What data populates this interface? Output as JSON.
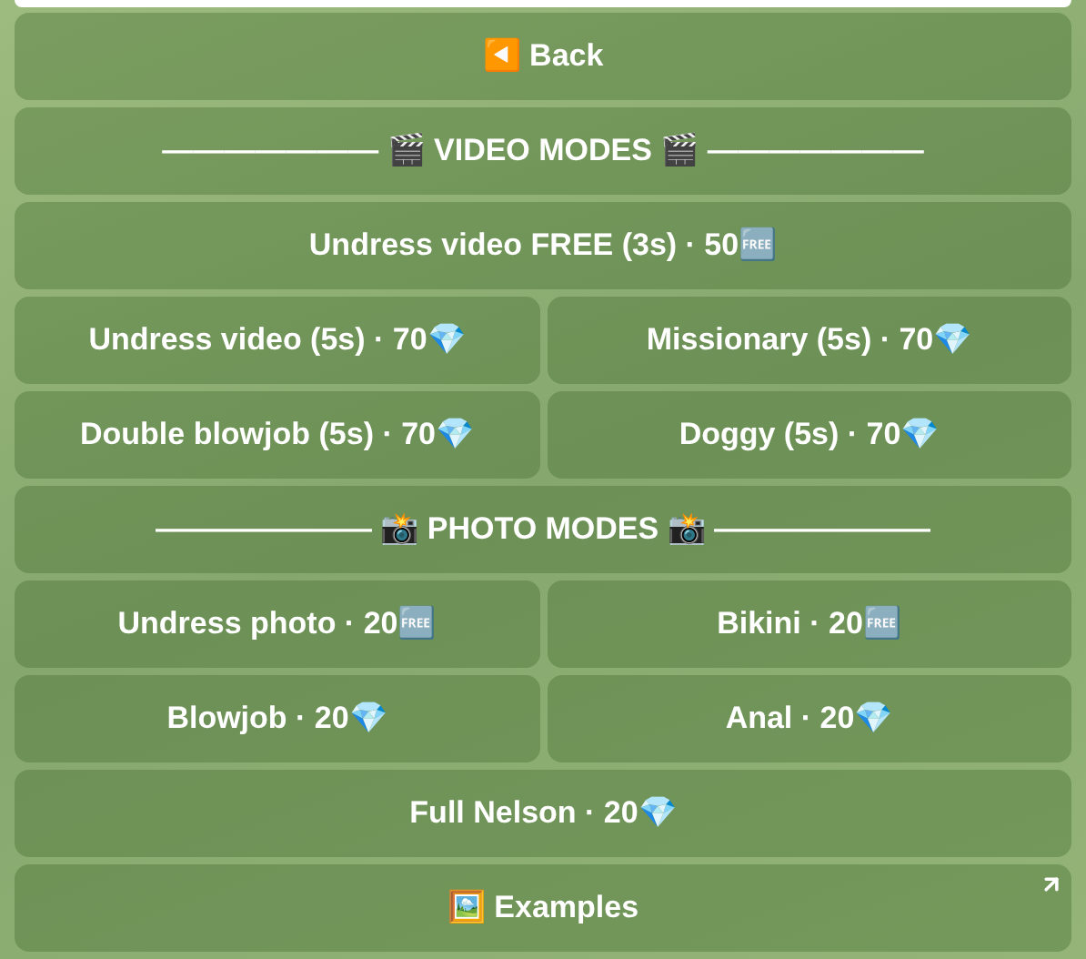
{
  "keyboard": [
    [
      {
        "label": "◀️ Back",
        "kind": "callback"
      }
    ],
    [
      {
        "label": "——————— 🎬 VIDEO MODES 🎬 ———————",
        "kind": "callback"
      }
    ],
    [
      {
        "label": "Undress video FREE (3s) · 50🆓",
        "kind": "callback"
      }
    ],
    [
      {
        "label": "Undress video (5s) · 70💎",
        "kind": "callback"
      },
      {
        "label": "Missionary (5s) · 70💎",
        "kind": "callback"
      }
    ],
    [
      {
        "label": "Double blowjob (5s) · 70💎",
        "kind": "callback"
      },
      {
        "label": "Doggy (5s) · 70💎",
        "kind": "callback"
      }
    ],
    [
      {
        "label": "——————— 📸 PHOTO MODES 📸 ———————",
        "kind": "callback"
      }
    ],
    [
      {
        "label": "Undress photo · 20🆓",
        "kind": "callback"
      },
      {
        "label": "Bikini · 20🆓",
        "kind": "callback"
      }
    ],
    [
      {
        "label": "Blowjob · 20💎",
        "kind": "callback"
      },
      {
        "label": "Anal · 20💎",
        "kind": "callback"
      }
    ],
    [
      {
        "label": "Full Nelson · 20💎",
        "kind": "callback"
      }
    ],
    [
      {
        "label": "🖼️ Examples",
        "kind": "url"
      }
    ]
  ]
}
